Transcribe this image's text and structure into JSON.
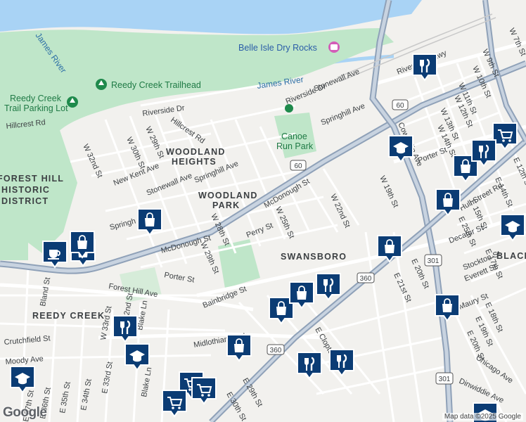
{
  "map": {
    "attribution": "Map data ©2025 Google",
    "logo": "Google",
    "colors": {
      "water": "#a9d3f5",
      "park": "#bfe6c9",
      "land": "#f2f1ee",
      "road": "#ffffff",
      "highway": "#8fa1b8",
      "marker": "#0b3c74"
    }
  },
  "labels": {
    "water": [
      "James River",
      "James River"
    ],
    "poi": [
      "Belle Isle Dry Rocks",
      "Reedy Creek Trailhead",
      "Reedy Creek",
      "Trail Parking Lot"
    ],
    "parks": [
      "Canoe",
      "Run Park"
    ],
    "areas": [
      "WOODLAND",
      "HEIGHTS",
      "WOODLAND",
      "PARK",
      "SWANSBORO",
      "REEDY CREEK",
      "BLACK",
      "FOREST HILL",
      "HISTORIC",
      "DISTRICT"
    ],
    "streets": [
      "Riverside Dr",
      "Hillcrest Rd",
      "Hillcrest Rd",
      "Riverside Dr",
      "Stonewall Ave",
      "Springhill Ave",
      "W 32nd St",
      "W 30th St",
      "W 29th St",
      "New Kent Ave",
      "Stonewall Ave",
      "Springhill Ave",
      "McDonough St",
      "McDonough St",
      "W 28th St",
      "W 29th St",
      "Perry St",
      "W 25th St",
      "McDonough St",
      "W 22nd St",
      "Porter St",
      "Bainbridge St",
      "Forest Hill Ave",
      "Bland St",
      "Crutchfield St",
      "Moody Ave",
      "W 33rd St",
      "W 32nd St",
      "Blake Ln",
      "Blake Ln",
      "Midlothian Tnpk",
      "E Clopton St",
      "E 30th St",
      "E 29th St",
      "E 37th St",
      "E 36th St",
      "E 35th St",
      "E 34th St",
      "E 33rd St",
      "E 32nd St",
      "W 19th St",
      "Cowardin Ave",
      "W 13th St",
      "W 14th St",
      "W 12th St",
      "W 11th St",
      "W 10th St",
      "W 9th St",
      "W 7th St",
      "Porter St",
      "Hull Street Rd",
      "E 12th St",
      "E 13th St",
      "E 14th St",
      "E 15th St",
      "Decatur St",
      "Stockton St",
      "E 17th St",
      "E 18th St",
      "E 19th St",
      "E 20th St",
      "Chicago Ave",
      "Dinwiddie Ave",
      "E 21st St",
      "E 20th St",
      "E 25th St",
      "Maury St",
      "Everett St",
      "Riverside Pkwy",
      "Springh",
      "Perry St",
      "Springhill Ave"
    ],
    "shields": [
      "60",
      "60",
      "360",
      "360",
      "301",
      "301"
    ]
  },
  "markers": [
    {
      "icon": "shopping-bag-icon"
    },
    {
      "icon": "coffee-icon"
    },
    {
      "icon": "shopping-bag-icon"
    },
    {
      "icon": "restaurant-icon"
    },
    {
      "icon": "graduation-cap-icon"
    },
    {
      "icon": "graduation-cap-icon"
    },
    {
      "icon": "shopping-bag-icon"
    },
    {
      "icon": "shopping-bag-icon"
    },
    {
      "icon": "restaurant-icon"
    },
    {
      "icon": "shopping-bag-icon"
    },
    {
      "icon": "shopping-bag-icon"
    },
    {
      "icon": "restaurant-icon"
    },
    {
      "icon": "restaurant-icon"
    },
    {
      "icon": "shopping-cart-icon"
    },
    {
      "icon": "shopping-cart-icon"
    },
    {
      "icon": "shopping-cart-icon"
    },
    {
      "icon": "restaurant-icon"
    },
    {
      "icon": "graduation-cap-icon"
    },
    {
      "icon": "shopping-bag-icon"
    },
    {
      "icon": "shopping-bag-icon"
    },
    {
      "icon": "shopping-cart-icon"
    },
    {
      "icon": "restaurant-icon"
    },
    {
      "icon": "shopping-bag-icon"
    },
    {
      "icon": "graduation-cap-icon"
    },
    {
      "icon": "shopping-bag-icon"
    },
    {
      "icon": "graduation-cap-icon"
    }
  ]
}
